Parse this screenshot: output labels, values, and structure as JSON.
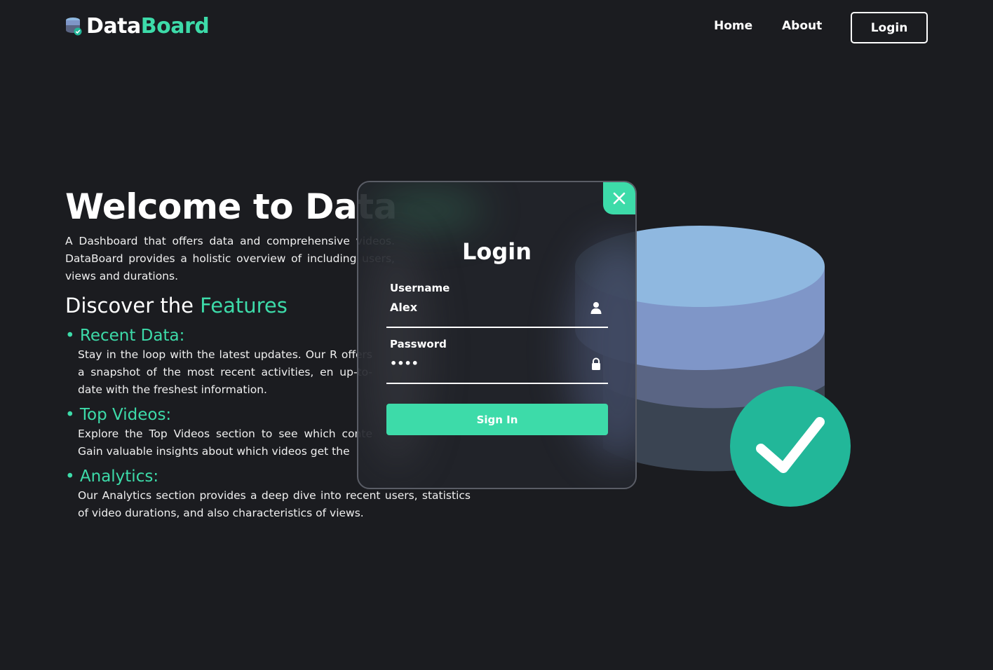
{
  "nav": {
    "logo_part1": "Data",
    "logo_part2": "Board",
    "home": "Home",
    "about": "About",
    "login": "Login"
  },
  "hero": {
    "title": "Welcome to Data",
    "intro": "A Dashboard that offers data and comprehensive videos. DataBoard provides a holistic overview of including users, views and durations.",
    "discover_prefix": "Discover the ",
    "discover_highlight": "Features",
    "features": [
      {
        "title": "• Recent Data:",
        "desc": "Stay in the loop with the latest updates. Our R offers a snapshot of the most recent activities, en up-to-date with the freshest information."
      },
      {
        "title": "• Top Videos:",
        "desc": "Explore the Top Videos section to see which conte Gain valuable insights about which videos get the"
      },
      {
        "title": "• Analytics:",
        "desc": "Our Analytics section provides a deep dive into recent users, statistics of video durations, and also characteristics of views."
      }
    ]
  },
  "modal": {
    "title": "Login",
    "username_label": "Username",
    "username_value": "Alex",
    "password_label": "Password",
    "password_value": "••••",
    "signin_label": "Sign In"
  },
  "colors": {
    "background": "#1b1c20",
    "accent": "#3ddba9",
    "check_circle": "#22b799",
    "db_top": "#8fb8e0",
    "db_mid": "#7f96c8",
    "db_low": "#5a6584",
    "db_bottom": "#3a4452"
  },
  "icons": [
    "database-icon",
    "close-icon",
    "user-icon",
    "lock-icon",
    "checkmark-icon"
  ]
}
